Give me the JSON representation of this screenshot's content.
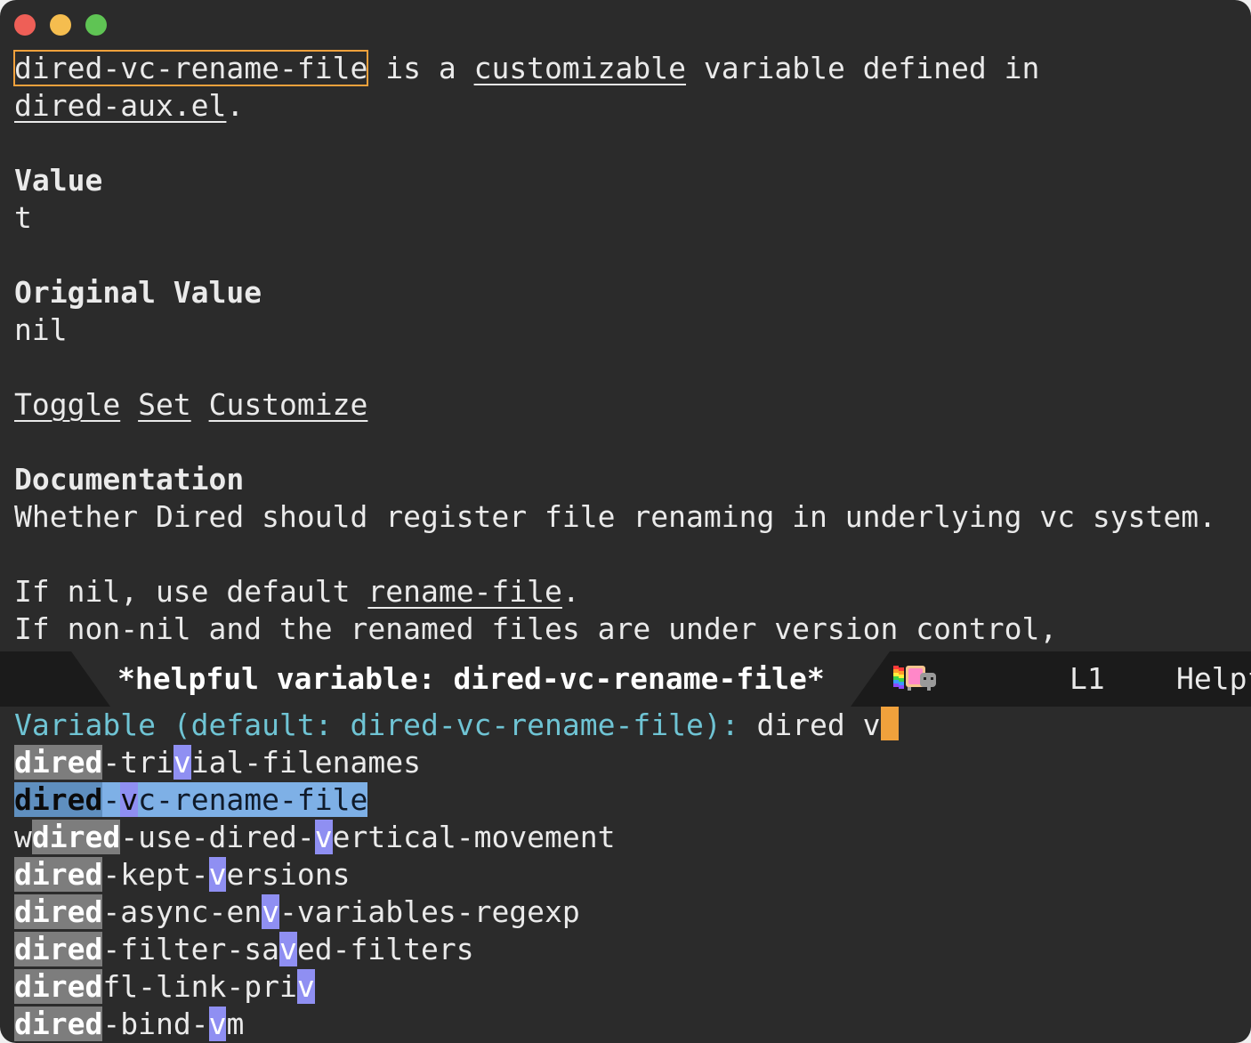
{
  "window": {
    "buttons": [
      "close",
      "minimize",
      "maximize"
    ]
  },
  "help": {
    "heading_var": "dired-vc-rename-file",
    "heading_is_a": " is a ",
    "heading_customizable": "customizable",
    "heading_rest": " variable defined in",
    "defined_in": "dired-aux.el",
    "defined_in_end": ".",
    "value_label": "Value",
    "value": "t",
    "original_label": "Original Value",
    "original_value": "nil",
    "buttons": {
      "toggle": "Toggle",
      "set": "Set",
      "customize": "Customize"
    },
    "doc_label": "Documentation",
    "doc_line1": "Whether Dired should register file renaming in underlying vc system.",
    "doc_line2_a": "If nil, use default ",
    "doc_line2_link": "rename-file",
    "doc_line2_b": ".",
    "doc_line3": "If non-nil and the renamed files are under version control,"
  },
  "modeline": {
    "buffer_name": "*helpful variable: dired-vc-rename-file*",
    "line": "L1",
    "mode": "Helpf",
    "nyan_icon": "nyan-cat-icon",
    "colors": {
      "bg": "#1b1b1b",
      "active": "#2b2b2b"
    }
  },
  "minibuffer": {
    "prompt": "Variable (default: dired-vc-rename-file): ",
    "input": "dired v",
    "candidates": [
      {
        "pre": "",
        "match1": "dired",
        "mid": "-tri",
        "match2": "v",
        "post": "ial-filenames",
        "selected": false
      },
      {
        "pre": "",
        "match1": "dired",
        "mid": "-",
        "match2": "v",
        "post": "c-rename-file",
        "selected": true
      },
      {
        "pre": "w",
        "match1": "dired",
        "mid": "-use-dired-",
        "match2": "v",
        "post": "ertical-movement",
        "selected": false
      },
      {
        "pre": "",
        "match1": "dired",
        "mid": "-kept-",
        "match2": "v",
        "post": "ersions",
        "selected": false
      },
      {
        "pre": "",
        "match1": "dired",
        "mid": "-async-en",
        "match2": "v",
        "post": "-variables-regexp",
        "selected": false
      },
      {
        "pre": "",
        "match1": "dired",
        "mid": "-filter-sa",
        "match2": "v",
        "post": "ed-filters",
        "selected": false
      },
      {
        "pre": "",
        "match1": "dired",
        "mid": "fl-link-pri",
        "match2": "v",
        "post": "",
        "selected": false
      },
      {
        "pre": "",
        "match1": "dired",
        "mid": "-bind-",
        "match2": "v",
        "post": "m",
        "selected": false
      }
    ],
    "colors": {
      "prompt": "#6fc4d4",
      "cursor": "#f0a13c",
      "match_dired": "#7d7d7d",
      "match_v": "#8f8ff2",
      "selected_bg": "#7eb0e6"
    }
  }
}
